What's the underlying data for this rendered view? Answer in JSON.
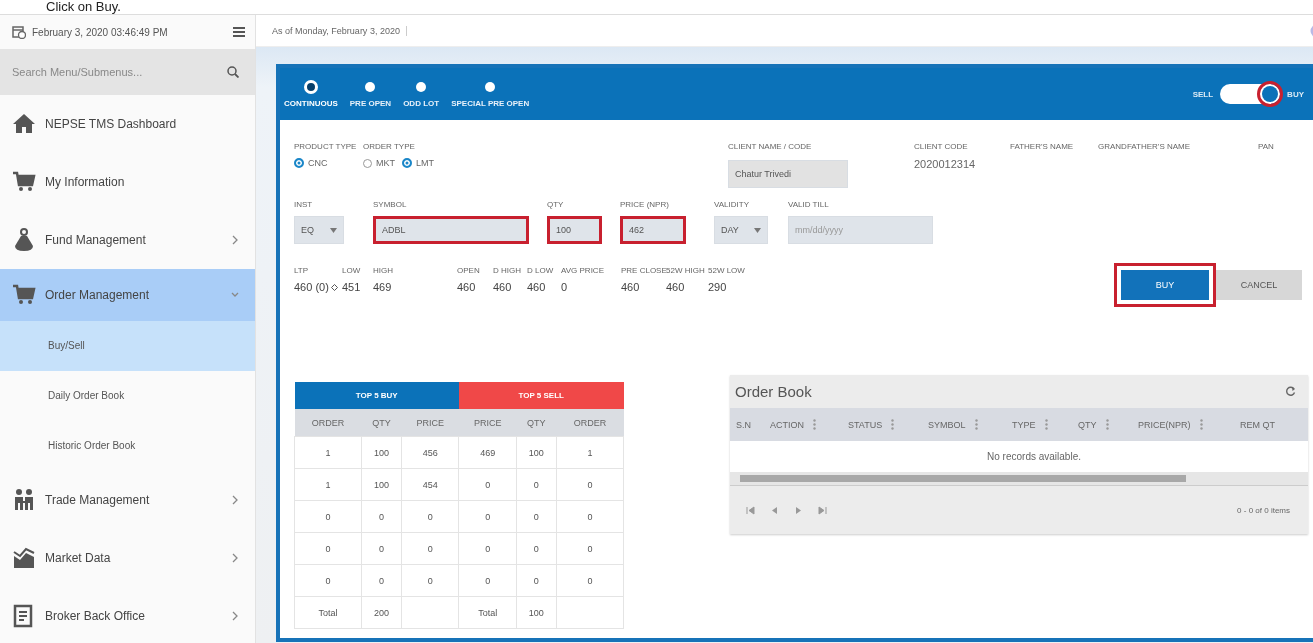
{
  "caption": "Click on Buy.",
  "header": {
    "datetime": "February 3, 2020 03:46:49 PM",
    "as_of": "As of Monday, February 3, 2020"
  },
  "sidebar": {
    "search_placeholder": "Search Menu/Submenus...",
    "items": [
      {
        "label": "NEPSE TMS Dashboard",
        "submenu": false,
        "expanded": false,
        "selected": false
      },
      {
        "label": "My Information",
        "submenu": false,
        "expanded": false,
        "selected": false
      },
      {
        "label": "Fund Management",
        "submenu": true,
        "expanded": false,
        "selected": false
      },
      {
        "label": "Order Management",
        "submenu": true,
        "expanded": true,
        "selected": true,
        "children": [
          {
            "label": "Buy/Sell",
            "selected": true
          },
          {
            "label": "Daily Order Book",
            "selected": false
          },
          {
            "label": "Historic Order Book",
            "selected": false
          }
        ]
      },
      {
        "label": "Trade Management",
        "submenu": true,
        "expanded": false,
        "selected": false
      },
      {
        "label": "Market Data",
        "submenu": true,
        "expanded": false,
        "selected": false
      },
      {
        "label": "Broker Back Office",
        "submenu": true,
        "expanded": false,
        "selected": false
      }
    ]
  },
  "sessions": [
    {
      "label": "CONTINUOUS",
      "selected": true
    },
    {
      "label": "PRE OPEN",
      "selected": false
    },
    {
      "label": "ODD LOT",
      "selected": false
    },
    {
      "label": "SPECIAL PRE OPEN",
      "selected": false
    }
  ],
  "side_toggle": {
    "sell_label": "SELL",
    "buy_label": "BUY",
    "buy_on": true,
    "highlighted": true
  },
  "product_type": {
    "label": "PRODUCT TYPE",
    "options": [
      {
        "label": "CNC",
        "selected": true
      }
    ]
  },
  "order_type": {
    "label": "ORDER TYPE",
    "options": [
      {
        "label": "MKT",
        "selected": false
      },
      {
        "label": "LMT",
        "selected": true
      }
    ]
  },
  "client": {
    "name_label": "CLIENT NAME / CODE",
    "name_value": "Chatur Trivedi",
    "code_label": "CLIENT CODE",
    "code_value": "2020012314",
    "father_label": "FATHER'S NAME",
    "grandfather_label": "GRANDFATHER'S NAME",
    "pan_label": "PAN"
  },
  "order_fields": [
    {
      "kind": "select",
      "label": "INST",
      "value": "EQ",
      "highlighted": false
    },
    {
      "kind": "input",
      "label": "SYMBOL",
      "value": "ADBL",
      "highlighted": true
    },
    {
      "kind": "input",
      "label": "QTY",
      "value": "100",
      "highlighted": true
    },
    {
      "kind": "input",
      "label": "PRICE (NPR)",
      "value": "462",
      "highlighted": true
    },
    {
      "kind": "select",
      "label": "VALIDITY",
      "value": "DAY",
      "highlighted": false
    },
    {
      "kind": "date",
      "label": "VALID TILL",
      "placeholder": "mm/dd/yyyy",
      "highlighted": false
    }
  ],
  "stats": [
    {
      "label": "LTP",
      "value": "460 (0)"
    },
    {
      "label": "LOW",
      "value": "451"
    },
    {
      "label": "HIGH",
      "value": "469"
    },
    {
      "label": "OPEN",
      "value": "460"
    },
    {
      "label": "D HIGH",
      "value": "460"
    },
    {
      "label": "D LOW",
      "value": "460"
    },
    {
      "label": "AVG PRICE",
      "value": "0"
    },
    {
      "label": "PRE CLOSE",
      "value": "460"
    },
    {
      "label": "52W HIGH",
      "value": "460"
    },
    {
      "label": "52W LOW",
      "value": "290"
    }
  ],
  "buttons": [
    {
      "kind": "primary",
      "label": "BUY",
      "highlighted": true
    },
    {
      "kind": "secondary",
      "label": "CANCEL",
      "highlighted": false
    }
  ],
  "top5": {
    "buy_title": "TOP 5 BUY",
    "sell_title": "TOP 5 SELL",
    "columns": [
      "ORDER",
      "QTY",
      "PRICE",
      "PRICE",
      "QTY",
      "ORDER"
    ],
    "rows": [
      [
        "1",
        "100",
        "456",
        "469",
        "100",
        "1"
      ],
      [
        "1",
        "100",
        "454",
        "0",
        "0",
        "0"
      ],
      [
        "0",
        "0",
        "0",
        "0",
        "0",
        "0"
      ],
      [
        "0",
        "0",
        "0",
        "0",
        "0",
        "0"
      ],
      [
        "0",
        "0",
        "0",
        "0",
        "0",
        "0"
      ]
    ],
    "total": {
      "buy_label": "Total",
      "buy_qty": "200",
      "sell_label": "Total",
      "sell_qty": "100"
    }
  },
  "order_book": {
    "title": "Order Book",
    "columns": [
      "S.N",
      "ACTION",
      "STATUS",
      "SYMBOL",
      "TYPE",
      "QTY",
      "PRICE(NPR)",
      "REM QT"
    ],
    "empty": "No records available.",
    "pager_info": "0 - 0 of 0 items"
  }
}
